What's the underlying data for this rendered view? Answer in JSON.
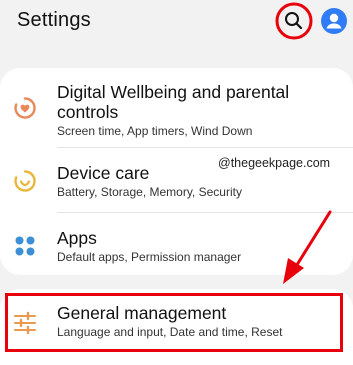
{
  "header": {
    "title": "Settings",
    "search_icon": "search-icon",
    "account_icon": "account-icon"
  },
  "colors": {
    "accent_red": "#e8000b",
    "account_blue": "#2f7cf6",
    "wellbeing_orange": "#e8895a",
    "device_care_yellow": "#e9b739",
    "apps_blue": "#3a8fd6",
    "general_orange": "#e99a4e"
  },
  "items": [
    {
      "title": "Digital Wellbeing and parental controls",
      "title_line1": "Digital Wellbeing and parental",
      "title_line2": "controls",
      "subtitle": "Screen time, App timers, Wind Down",
      "icon": "digital-wellbeing-icon"
    },
    {
      "title": "Device care",
      "subtitle": "Battery, Storage, Memory, Security",
      "icon": "device-care-icon"
    },
    {
      "title": "Apps",
      "subtitle": "Default apps, Permission manager",
      "icon": "apps-icon"
    },
    {
      "title": "General management",
      "subtitle": "Language and input, Date and time, Reset",
      "icon": "general-management-icon"
    }
  ],
  "watermark": "@thegeekpage.com"
}
